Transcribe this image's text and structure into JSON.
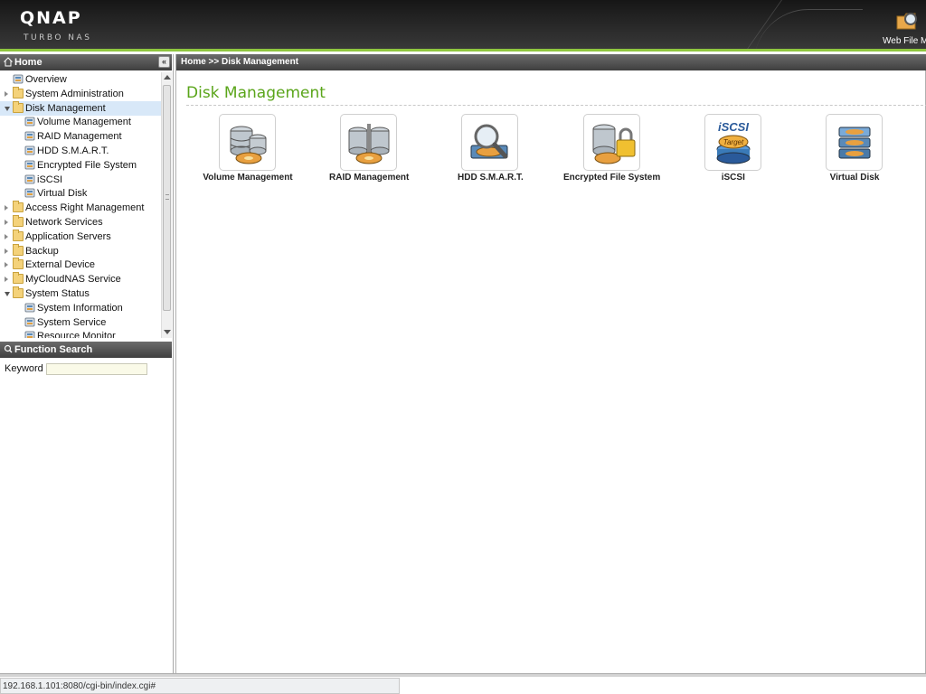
{
  "header": {
    "logo": "QNAP",
    "subtitle": "Turbo NAS",
    "web_file_manager": "Web File Ma"
  },
  "left_panel": {
    "home_title": "Home",
    "tree": [
      {
        "label": "Overview",
        "icon": "overview-icon",
        "level": 0,
        "expander": "none"
      },
      {
        "label": "System Administration",
        "icon": "folder-icon",
        "level": 0,
        "expander": "closed"
      },
      {
        "label": "Disk Management",
        "icon": "folder-open-icon",
        "level": 0,
        "expander": "open",
        "selected": true
      },
      {
        "label": "Volume Management",
        "icon": "volume-icon",
        "level": 1,
        "expander": "none"
      },
      {
        "label": "RAID Management",
        "icon": "raid-icon",
        "level": 1,
        "expander": "none"
      },
      {
        "label": "HDD S.M.A.R.T.",
        "icon": "hdd-smart-icon",
        "level": 1,
        "expander": "none"
      },
      {
        "label": "Encrypted File System",
        "icon": "encrypted-icon",
        "level": 1,
        "expander": "none"
      },
      {
        "label": "iSCSI",
        "icon": "iscsi-icon",
        "level": 1,
        "expander": "none"
      },
      {
        "label": "Virtual Disk",
        "icon": "virtual-disk-icon",
        "level": 1,
        "expander": "none"
      },
      {
        "label": "Access Right Management",
        "icon": "folder-icon",
        "level": 0,
        "expander": "closed"
      },
      {
        "label": "Network Services",
        "icon": "folder-icon",
        "level": 0,
        "expander": "closed"
      },
      {
        "label": "Application Servers",
        "icon": "folder-icon",
        "level": 0,
        "expander": "closed"
      },
      {
        "label": "Backup",
        "icon": "folder-icon",
        "level": 0,
        "expander": "closed"
      },
      {
        "label": "External Device",
        "icon": "folder-icon",
        "level": 0,
        "expander": "closed"
      },
      {
        "label": "MyCloudNAS Service",
        "icon": "folder-icon",
        "level": 0,
        "expander": "closed"
      },
      {
        "label": "System Status",
        "icon": "folder-open-icon",
        "level": 0,
        "expander": "open"
      },
      {
        "label": "System Information",
        "icon": "system-info-icon",
        "level": 1,
        "expander": "none"
      },
      {
        "label": "System Service",
        "icon": "system-service-icon",
        "level": 1,
        "expander": "none"
      },
      {
        "label": "Resource Monitor",
        "icon": "resource-monitor-icon",
        "level": 1,
        "expander": "none"
      }
    ],
    "function_search": {
      "title": "Function Search",
      "keyword_label": "Keyword :",
      "keyword_value": ""
    }
  },
  "main": {
    "breadcrumb": "Home >> Disk Management",
    "title": "Disk Management",
    "tiles": [
      {
        "label": "Volume Management",
        "icon": "volume-management-icon"
      },
      {
        "label": "RAID Management",
        "icon": "raid-management-icon"
      },
      {
        "label": "HDD S.M.A.R.T.",
        "icon": "hdd-smart-icon"
      },
      {
        "label": "Encrypted File System",
        "icon": "encrypted-file-system-icon"
      },
      {
        "label": "iSCSI",
        "icon": "iscsi-icon"
      },
      {
        "label": "Virtual Disk",
        "icon": "virtual-disk-icon"
      }
    ]
  },
  "status_bar": {
    "url": "192.168.1.101:8080/cgi-bin/index.cgi#"
  },
  "colors": {
    "accent_green": "#8fc63f",
    "title_green": "#5aa51a",
    "header_dark": "#2c2c2c",
    "selection": "#d8e8f8"
  }
}
